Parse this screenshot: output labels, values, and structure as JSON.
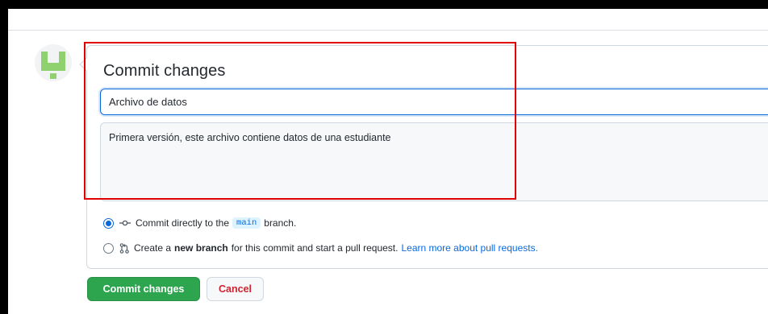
{
  "commit": {
    "title": "Commit changes",
    "summary_value": "Archivo de datos",
    "description_value": "Primera versión, este archivo contiene datos de una estudiante"
  },
  "options": {
    "direct": {
      "text_before": "Commit directly to the",
      "branch": "main",
      "text_after": "branch.",
      "selected": true
    },
    "new_branch": {
      "text_before": "Create a",
      "bold": "new branch",
      "text_after": "for this commit and start a pull request.",
      "link": "Learn more about pull requests.",
      "selected": false
    }
  },
  "buttons": {
    "commit_label": "Commit changes",
    "cancel_label": "Cancel"
  },
  "icons": {
    "avatar": "identicon-avatar",
    "commit": "git-commit-icon",
    "pull_request": "git-pull-request-icon"
  },
  "colors": {
    "accent": "#0969da",
    "primary_button": "#2da44e",
    "danger": "#cf222e",
    "highlight": "#e10000",
    "avatar": "#8fd16f"
  }
}
